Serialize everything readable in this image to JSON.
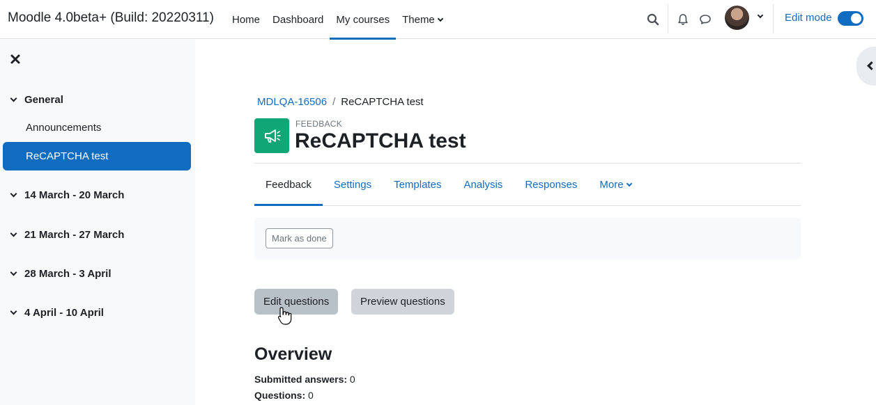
{
  "site": {
    "name": "Moodle 4.0beta+ (Build: 20220311)"
  },
  "nav": {
    "items": [
      {
        "label": "Home",
        "active": false
      },
      {
        "label": "Dashboard",
        "active": false
      },
      {
        "label": "My courses",
        "active": true
      },
      {
        "label": "Theme",
        "active": false,
        "dropdown": true
      }
    ],
    "icons": [
      "search-icon",
      "bell-icon",
      "chat-icon"
    ],
    "edit_mode_label": "Edit mode",
    "edit_mode_on": true
  },
  "drawer": {
    "sections": [
      {
        "label": "General",
        "activities": [
          "Announcements",
          "ReCAPTCHA test"
        ]
      },
      {
        "label": "14 March - 20 March"
      },
      {
        "label": "21 March - 27 March"
      },
      {
        "label": "28 March - 3 April"
      },
      {
        "label": "4 April - 10 April"
      }
    ],
    "current_activity": "ReCAPTCHA test"
  },
  "breadcrumb": {
    "course": "MDLQA-16506",
    "separator": "/",
    "current": "ReCAPTCHA test"
  },
  "activity": {
    "type_label": "FEEDBACK",
    "title": "ReCAPTCHA test",
    "icon": "megaphone-icon",
    "icon_color": "#11a676"
  },
  "tabs": [
    {
      "label": "Feedback",
      "active": true
    },
    {
      "label": "Settings"
    },
    {
      "label": "Templates"
    },
    {
      "label": "Analysis"
    },
    {
      "label": "Responses"
    },
    {
      "label": "More",
      "dropdown": true
    }
  ],
  "completion": {
    "mark_done_label": "Mark as done"
  },
  "actions": {
    "edit_questions": "Edit questions",
    "preview_questions": "Preview questions"
  },
  "overview": {
    "heading": "Overview",
    "submitted_label": "Submitted answers:",
    "submitted_value": "0",
    "questions_label": "Questions:",
    "questions_value": "0"
  },
  "colors": {
    "primary": "#0f6cbf",
    "text": "#1d2125",
    "drawer_bg": "#f8f9fa"
  }
}
